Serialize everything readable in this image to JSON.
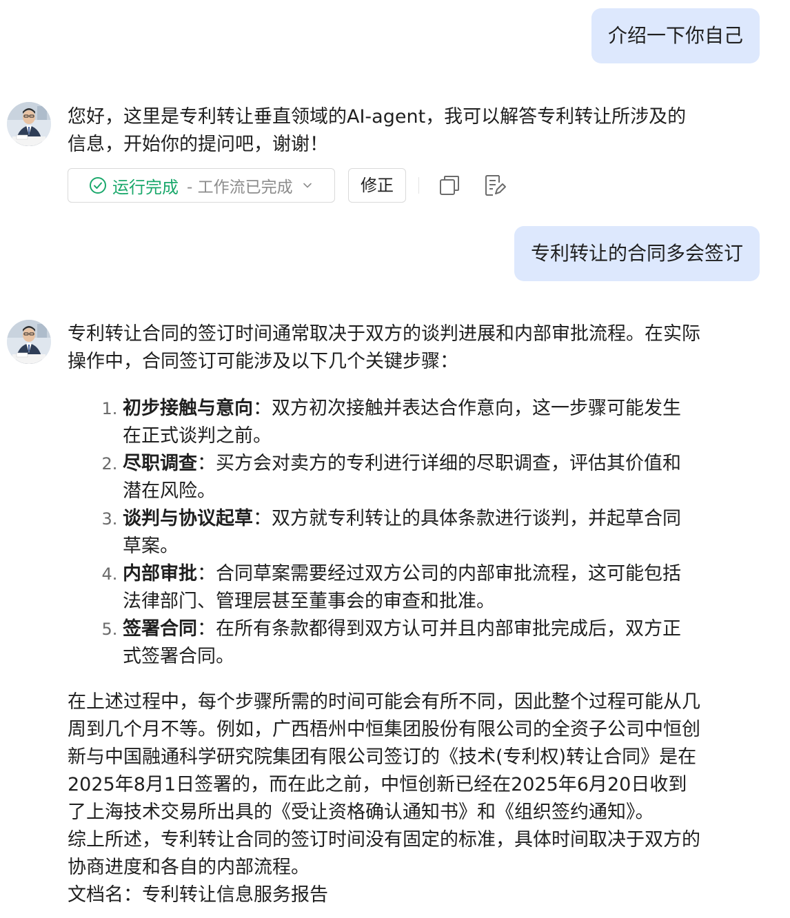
{
  "conversation": {
    "user_message_1": "介绍一下你自己",
    "assistant_message_1": "您好，这里是专利转让垂直领域的AI-agent，我可以解答专利转让所涉及的信息，开始你的提问吧，谢谢！",
    "status": {
      "label": "运行完成",
      "detail": "- 工作流已完成",
      "color": "#1aa86b"
    },
    "fix_label": "修正",
    "user_message_2": "专利转让的合同多会签订",
    "assistant_message_2": {
      "intro": "专利转让合同的签订时间通常取决于双方的谈判进展和内部审批流程。在实际操作中，合同签订可能涉及以下几个关键步骤：",
      "steps": [
        {
          "title": "初步接触与意向",
          "text": "：双方初次接触并表达合作意向，这一步骤可能发生在正式谈判之前。"
        },
        {
          "title": "尽职调查",
          "text": "：买方会对卖方的专利进行详细的尽职调查，评估其价值和潜在风险。"
        },
        {
          "title": "谈判与协议起草",
          "text": "：双方就专利转让的具体条款进行谈判，并起草合同草案。"
        },
        {
          "title": "内部审批",
          "text": "：合同草案需要经过双方公司的内部审批流程，这可能包括法律部门、管理层甚至董事会的审查和批准。"
        },
        {
          "title": "签署合同",
          "text": "：在所有条款都得到双方认可并且内部审批完成后，双方正式签署合同。"
        }
      ],
      "paragraph_1": "在上述过程中，每个步骤所需的时间可能会有所不同，因此整个过程可能从几周到几个月不等。例如，广西梧州中恒集团股份有限公司的全资子公司中恒创新与中国融通科学研究院集团有限公司签订的《技术(专利权)转让合同》是在2025年8月1日签署的，而在此之前，中恒创新已经在2025年6月20日收到了上海技术交易所出具的《受让资格确认通知书》和《组织签约通知》。",
      "paragraph_2": "综上所述，专利转让合同的签订时间没有固定的标准，具体时间取决于双方的协商进度和各自的内部流程。",
      "paragraph_3": "文档名：专利转让信息服务报告"
    }
  },
  "icons": {
    "status": "check-circle-icon",
    "expand": "chevron-down-icon",
    "copy": "copy-icon",
    "edit": "edit-note-icon"
  },
  "colors": {
    "user_bubble": "#dde8fd",
    "success": "#1aa86b"
  }
}
